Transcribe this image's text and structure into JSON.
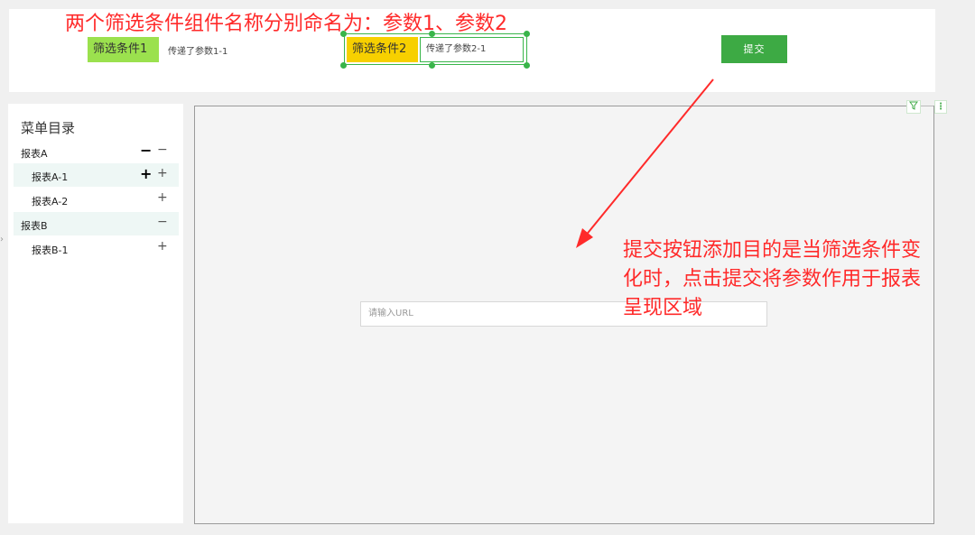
{
  "annotations": {
    "top": "两个筛选条件组件名称分别命名为：参数1、参数2",
    "right_line1": "提交按钮添加目的是当筛选条件变",
    "right_line2": "化时，点击提交将参数作用于报表",
    "right_line3": "呈现区域",
    "color": "#ff2a2a"
  },
  "filters": [
    {
      "label": "筛选条件1",
      "value": "传递了参数1-1",
      "color": "#9be14e"
    },
    {
      "label": "筛选条件2",
      "value": "传递了参数2-1",
      "color": "#f7d000"
    }
  ],
  "submit": {
    "label": "提交",
    "color": "#3daa44"
  },
  "sidebar": {
    "title": "菜单目录",
    "items": [
      {
        "label": "报表A",
        "sign": "−",
        "bold": "−"
      },
      {
        "label": "报表A-1",
        "sign": "+",
        "bold": "+"
      },
      {
        "label": "报表A-2",
        "sign": "+"
      },
      {
        "label": "报表B",
        "sign": "−"
      },
      {
        "label": "报表B-1",
        "sign": "+"
      }
    ]
  },
  "main": {
    "url_placeholder": "请输入URL",
    "filter_icon": "funnel-icon",
    "more_icon": "more-vertical-icon"
  }
}
